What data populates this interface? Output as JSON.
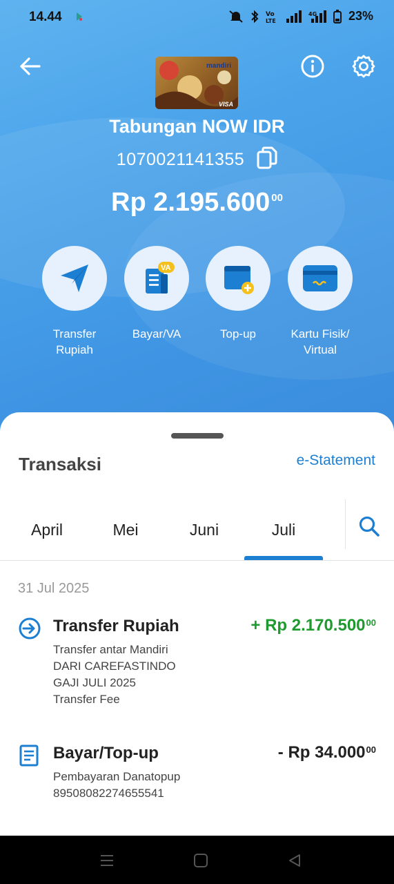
{
  "status_bar": {
    "time": "14.44",
    "battery": "23%"
  },
  "account": {
    "title": "Tabungan NOW IDR",
    "number": "1070021141355",
    "balance_main": "Rp 2.195.600",
    "balance_cents": "00",
    "card_brand": "VISA",
    "card_bank": "mandiri"
  },
  "menu": [
    {
      "line1": "Transfer",
      "line2": "Rupiah",
      "icon": "paper-plane-icon"
    },
    {
      "line1": "Bayar/VA",
      "line2": "",
      "icon": "bill-va-icon"
    },
    {
      "line1": "Top-up",
      "line2": "",
      "icon": "wallet-topup-icon"
    },
    {
      "line1": "Kartu Fisik/",
      "line2": "Virtual",
      "icon": "card-icon"
    }
  ],
  "transactions_section": {
    "title": "Transaksi",
    "estatement": "e-Statement",
    "tabs": [
      "April",
      "Mei",
      "Juni",
      "Juli"
    ],
    "active_tab": "Juli"
  },
  "date_group": "31 Jul 2025",
  "transactions": [
    {
      "name": "Transfer Rupiah",
      "amount": "+ Rp 2.170.500",
      "cents": "00",
      "color": "#1e9a2f",
      "lines": [
        "Transfer antar Mandiri",
        "DARI CAREFASTINDO",
        "GAJI JULI 2025",
        "Transfer Fee"
      ]
    },
    {
      "name": "Bayar/Top-up",
      "amount": "- Rp 34.000",
      "cents": "00",
      "color": "#222222",
      "lines": [
        "Pembayaran Danatopup",
        "89508082274655541"
      ]
    }
  ]
}
